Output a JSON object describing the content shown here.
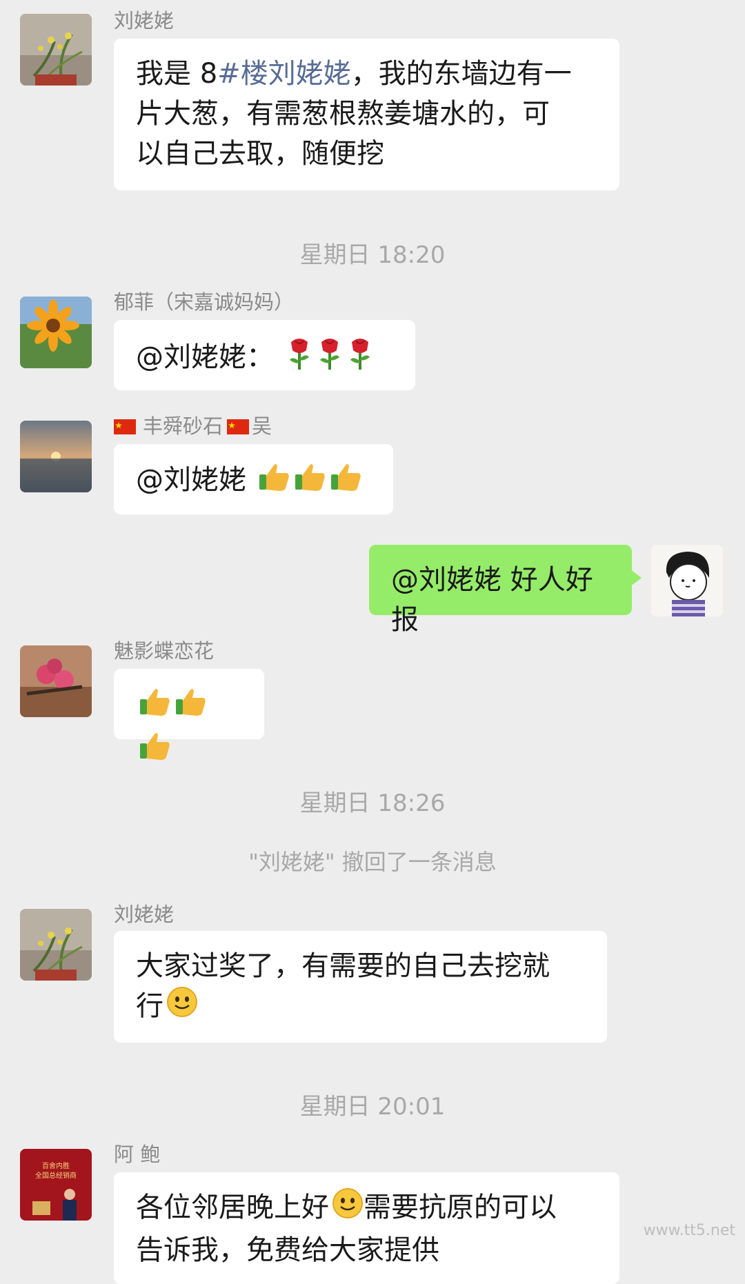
{
  "messages": [
    {
      "sender": "刘姥姥",
      "text_pre": "我是 8",
      "text_tag": "#楼刘姥姥",
      "text_line1_rest": "，我的东墙边有一",
      "text_line2": "片大葱，有需葱根熬姜塘水的，可",
      "text_line3": "以自己去取，随便挖"
    },
    {
      "timestamp": "星期日 18:20"
    },
    {
      "sender": "郁菲（宋嘉诚妈妈）",
      "text": "@刘姥姥："
    },
    {
      "sender_pre": "丰舜砂石",
      "sender_post": "吴",
      "text": "@刘姥姥"
    },
    {
      "text": "@刘姥姥 好人好报"
    },
    {
      "sender": "魅影蝶恋花"
    },
    {
      "timestamp": "星期日 18:26"
    },
    {
      "system": "\"刘姥姥\" 撤回了一条消息"
    },
    {
      "sender": "刘姥姥",
      "text_line1": "大家过奖了，有需要的自己去挖就",
      "text_line2": "行"
    },
    {
      "timestamp": "星期日 20:01"
    },
    {
      "sender": "阿 鲍",
      "text_line1_pre": "各位邻居晚上好",
      "text_line1_post": "需要抗原的可以",
      "text_line2": "告诉我，免费给大家提供"
    }
  ],
  "avatar_text": {
    "line1": "百舍内胜",
    "line2": "全国总经销商"
  },
  "watermark": "www.tt5.net",
  "colors": {
    "me_bubble": "#95ec69",
    "other_bubble": "#ffffff",
    "bg": "#ededed",
    "tag": "#576b95"
  },
  "icons": [
    "rose-emoji",
    "thumbs-up-emoji",
    "smile-emoji",
    "china-flag-icon"
  ]
}
